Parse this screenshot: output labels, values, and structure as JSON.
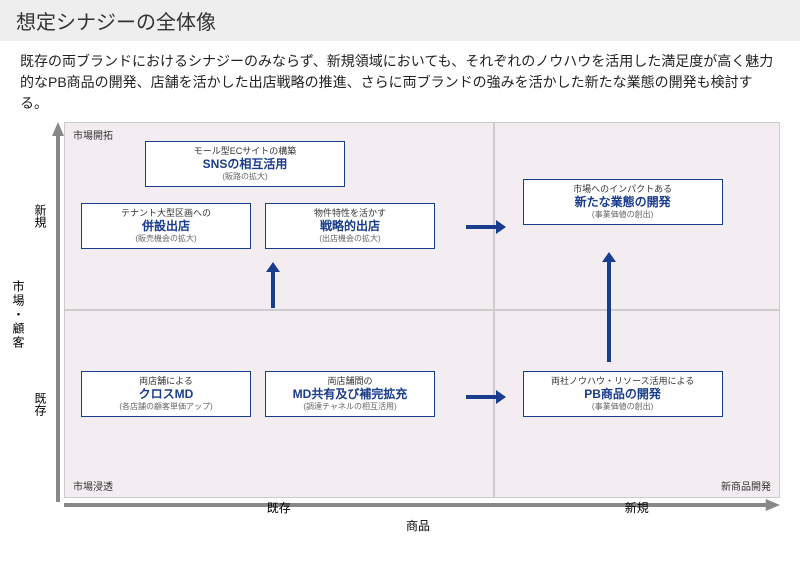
{
  "title": "想定シナジーの全体像",
  "intro": "既存の両ブランドにおけるシナジーのみならず、新規領域においても、それぞれのノウハウを活用した満足度が高く魅力的なPB商品の開発、店舗を活かした出店戦略の推進、さらに両ブランドの強みを活かした新たな業態の開発も検討する。",
  "axes": {
    "y_label": "市場・顧客",
    "x_label": "商品",
    "y_segments": [
      "新規",
      "既存"
    ],
    "x_segments": [
      "既存",
      "新規"
    ],
    "corner_tl": "市場開拓",
    "corner_bl": "市場浸透",
    "corner_br_top": "",
    "corner_br_bottom": "新商品開発"
  },
  "boxes": {
    "ec": {
      "sub": "モール型ECサイトの構築",
      "main": "SNSの相互活用",
      "note": "(販路の拡大)"
    },
    "tenant": {
      "sub": "テナント大型区画への",
      "main": "併設出店",
      "note": "(販売機会の拡大)"
    },
    "strategic": {
      "sub": "物件特性を活かす",
      "main": "戦略的出店",
      "note": "(出店機会の拡大)"
    },
    "newbiz": {
      "sub": "市場へのインパクトある",
      "main": "新たな業態の開発",
      "note": "(事業価値の創出)"
    },
    "crossmd": {
      "sub": "両店舗による",
      "main": "クロスMD",
      "note": "(各店舗の顧客単価アップ)"
    },
    "mdshare": {
      "sub": "両店舗間の",
      "main": "MD共有及び補完拡充",
      "note": "(調達チャネルの相互活用)"
    },
    "pb": {
      "sub": "両社ノウハウ・リソース活用による",
      "main": "PB商品の開発",
      "note": "(事業価値の創出)"
    }
  }
}
